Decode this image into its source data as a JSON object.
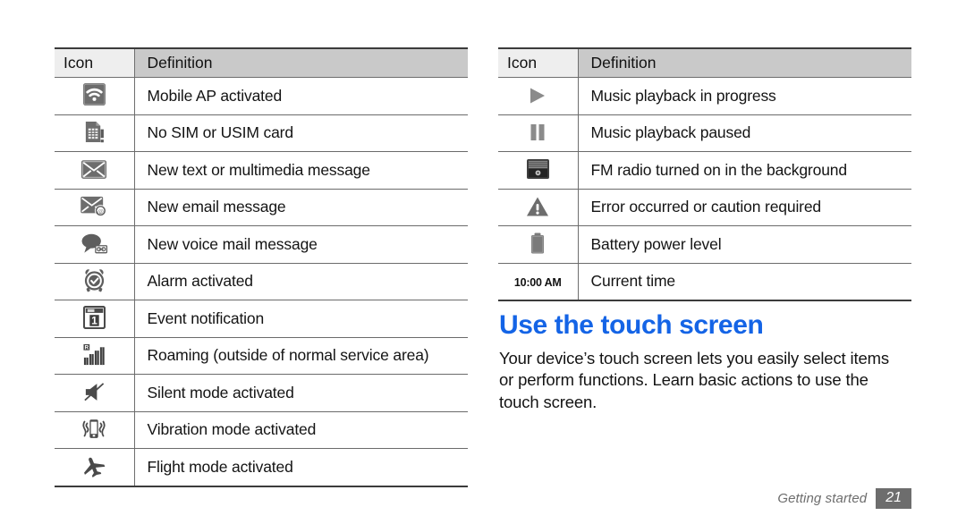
{
  "page": {
    "footer_section": "Getting started",
    "footer_page_number": "21",
    "heading_color": "#1464e6"
  },
  "left_table": {
    "headers": {
      "icon": "Icon",
      "definition": "Definition"
    },
    "rows": [
      {
        "icon": "mobile-ap-wifi-icon",
        "definition": "Mobile AP activated"
      },
      {
        "icon": "no-sim-card-icon",
        "definition": "No SIM or USIM card"
      },
      {
        "icon": "new-message-envelope-icon",
        "definition": "New text or multimedia message"
      },
      {
        "icon": "new-email-icon",
        "definition": "New email message"
      },
      {
        "icon": "new-voicemail-icon",
        "definition": "New voice mail message"
      },
      {
        "icon": "alarm-clock-icon",
        "definition": "Alarm activated"
      },
      {
        "icon": "event-calendar-icon",
        "definition": "Event notification"
      },
      {
        "icon": "roaming-signal-bars-icon",
        "definition": "Roaming (outside of normal service area)"
      },
      {
        "icon": "silent-mode-muted-speaker-icon",
        "definition": "Silent mode activated"
      },
      {
        "icon": "vibration-mode-icon",
        "definition": "Vibration mode activated"
      },
      {
        "icon": "flight-mode-airplane-icon",
        "definition": "Flight mode activated"
      }
    ]
  },
  "right_table": {
    "headers": {
      "icon": "Icon",
      "definition": "Definition"
    },
    "rows": [
      {
        "icon": "music-play-icon",
        "definition": "Music playback in progress"
      },
      {
        "icon": "music-pause-icon",
        "definition": "Music playback paused"
      },
      {
        "icon": "fm-radio-icon",
        "definition": "FM radio turned on in the background"
      },
      {
        "icon": "warning-triangle-icon",
        "definition": "Error occurred or caution required"
      },
      {
        "icon": "battery-icon",
        "definition": "Battery power level"
      },
      {
        "icon": "current-time-text",
        "icon_text": "10:00 AM",
        "definition": "Current time"
      }
    ]
  },
  "article": {
    "heading": "Use the touch screen",
    "body": "Your device’s touch screen lets you easily select items or perform functions. Learn basic actions to use the touch screen."
  }
}
